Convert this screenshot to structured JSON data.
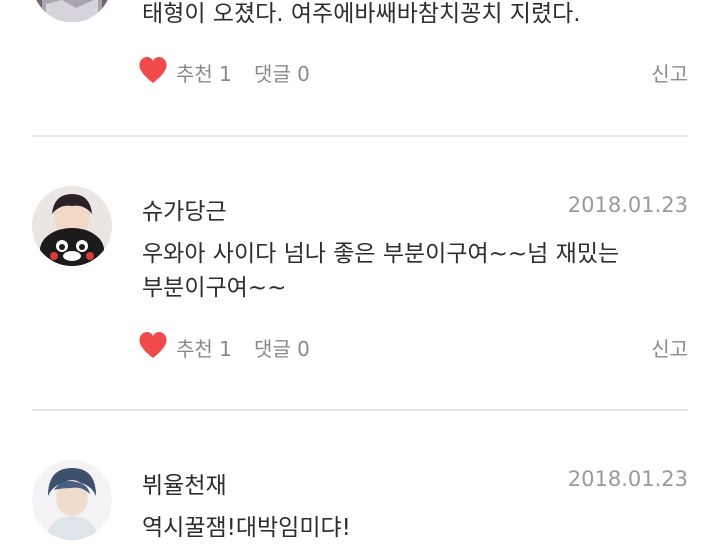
{
  "comments": [
    {
      "author": "",
      "date": "",
      "text": "태형이 오졌다. 여주에바쌔바참치꽁치 지렸다.",
      "like_label": "추천 1",
      "comment_label": "댓글 0",
      "report_label": "신고"
    },
    {
      "author": "슈가당근",
      "date": "2018.01.23",
      "text": "우와아 사이다 넘나 좋은 부분이구여~~넘 재밌는\n부분이구여~~",
      "like_label": "추천 1",
      "comment_label": "댓글 0",
      "report_label": "신고"
    },
    {
      "author": "뷔율천재",
      "date": "2018.01.23",
      "text": "역시꿀잼!대박임미댜!",
      "like_label": "",
      "comment_label": "",
      "report_label": ""
    }
  ],
  "colors": {
    "heart": "#f04a4a",
    "divider": "#e6e6e6",
    "meta_text": "#8a8a8a",
    "date_text": "#9a9a9a"
  }
}
